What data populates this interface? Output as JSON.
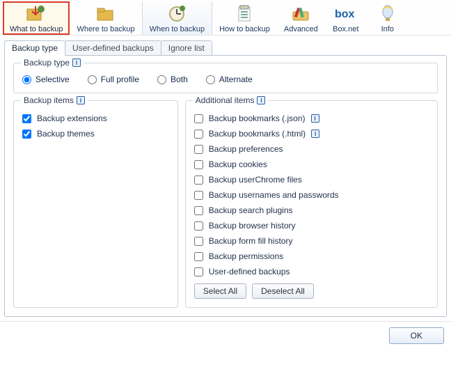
{
  "toolbar": {
    "items": [
      {
        "label": "What to backup",
        "selected": true
      },
      {
        "label": "Where to backup"
      },
      {
        "label": "When to backup",
        "special": true
      },
      {
        "label": "How to backup"
      },
      {
        "label": "Advanced"
      },
      {
        "label": "Box.net"
      },
      {
        "label": "Info"
      }
    ]
  },
  "tabs": [
    {
      "label": "Backup type",
      "active": true
    },
    {
      "label": "User-defined backups"
    },
    {
      "label": "Ignore list"
    }
  ],
  "backup_type": {
    "legend": "Backup type",
    "options": [
      {
        "label": "Selective",
        "checked": true
      },
      {
        "label": "Full profile"
      },
      {
        "label": "Both"
      },
      {
        "label": "Alternate"
      }
    ]
  },
  "backup_items": {
    "legend": "Backup items",
    "items": [
      {
        "label": "Backup extensions",
        "checked": true
      },
      {
        "label": "Backup themes",
        "checked": true
      }
    ]
  },
  "additional_items": {
    "legend": "Additional items",
    "items": [
      {
        "label": "Backup bookmarks (.json)",
        "info": true
      },
      {
        "label": "Backup bookmarks (.html)",
        "info": true
      },
      {
        "label": "Backup preferences"
      },
      {
        "label": "Backup cookies"
      },
      {
        "label": "Backup userChrome files"
      },
      {
        "label": "Backup usernames and passwords"
      },
      {
        "label": "Backup search plugins"
      },
      {
        "label": "Backup browser history"
      },
      {
        "label": "Backup form fill history"
      },
      {
        "label": "Backup permissions"
      },
      {
        "label": "User-defined backups"
      }
    ],
    "select_all": "Select All",
    "deselect_all": "Deselect All"
  },
  "footer": {
    "ok": "OK"
  }
}
